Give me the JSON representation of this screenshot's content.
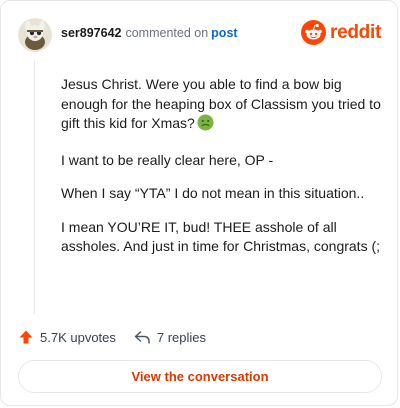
{
  "comment": {
    "username": "ser897642",
    "commented_text": "commented on",
    "post_link": "post",
    "paragraphs": [
      "Jesus Christ. Were you able to find a bow big enough for the heaping box of Classism you tried to gift this kid for Xmas?",
      "I want to be really clear here, OP -",
      "When I say “YTA” I do not mean in this situation..",
      "I mean YOU’RE IT, bud! THEE asshole of all assholes. And just in time for Christmas, congrats (;"
    ],
    "emoji": "nauseated-face-icon"
  },
  "brand": {
    "name": "reddit",
    "color": "#ff4500"
  },
  "actions": {
    "upvotes": "5.7K upvotes",
    "replies": "7 replies"
  },
  "cta": {
    "label": "View the conversation"
  }
}
